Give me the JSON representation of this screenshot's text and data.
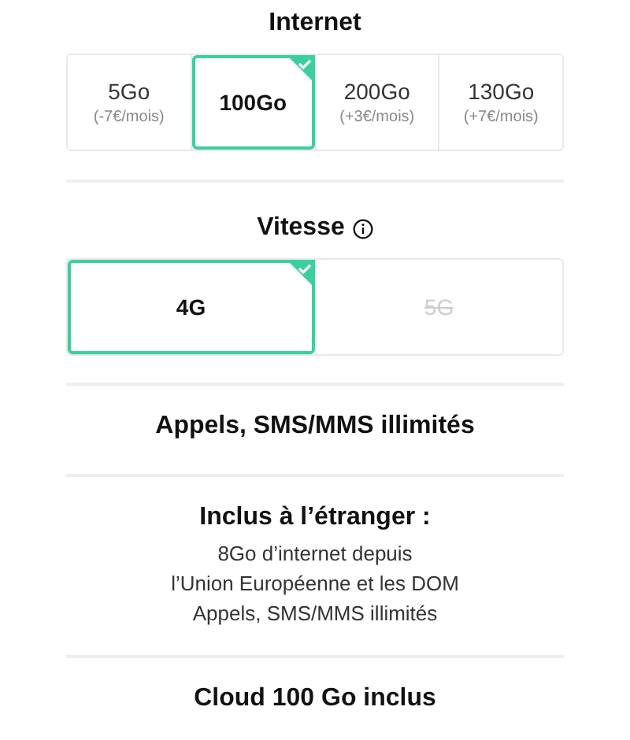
{
  "internet": {
    "title": "Internet",
    "options": [
      {
        "label": "5Go",
        "note": "(-7€/mois)",
        "selected": false
      },
      {
        "label": "100Go",
        "selected": true
      },
      {
        "label": "200Go",
        "note": "(+3€/mois)",
        "selected": false
      },
      {
        "label": "130Go",
        "note": "(+7€/mois)",
        "selected": false
      }
    ]
  },
  "speed": {
    "title": "Vitesse",
    "info_icon": true,
    "options": [
      {
        "label": "4G",
        "selected": true,
        "disabled": false
      },
      {
        "label": "5G",
        "selected": false,
        "disabled": true
      }
    ]
  },
  "features": [
    {
      "kind": "heading",
      "title": "Appels, SMS/MMS illimités"
    },
    {
      "kind": "detail",
      "title": "Inclus à l’étranger :",
      "lines": [
        "8Go d’internet depuis",
        "l’Union Européenne et les DOM",
        "Appels, SMS/MMS illimités"
      ]
    },
    {
      "kind": "heading",
      "title": "Cloud 100 Go inclus"
    }
  ]
}
